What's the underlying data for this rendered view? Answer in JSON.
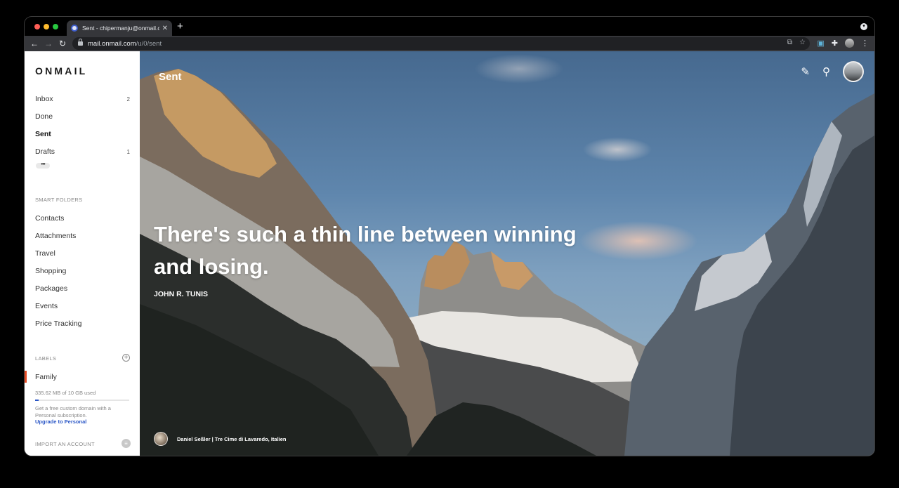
{
  "browser": {
    "tab_title": "Sent - chipermanju@onmail.com",
    "new_tab": "+",
    "url_host": "mail.onmail.com",
    "url_path": "/u/0/sent"
  },
  "sidebar": {
    "logo": "ONMAIL",
    "nav": [
      {
        "label": "Inbox",
        "count": "2"
      },
      {
        "label": "Done",
        "count": ""
      },
      {
        "label": "Sent",
        "count": ""
      },
      {
        "label": "Drafts",
        "count": "1"
      }
    ],
    "more": "•••",
    "smart_folders_heading": "SMART FOLDERS",
    "smart_folders": [
      "Contacts",
      "Attachments",
      "Travel",
      "Shopping",
      "Packages",
      "Events",
      "Price Tracking"
    ],
    "labels_heading": "LABELS",
    "labels": [
      "Family"
    ],
    "storage_text": "335.62 MB of 10 GB used",
    "storage_fraction": 0.034,
    "promo_text": "Get a free custom domain with a Personal subscription.",
    "upgrade_link": "Upgrade to Personal",
    "import_heading": "IMPORT AN ACCOUNT"
  },
  "main": {
    "title": "Sent",
    "quote": "There's such a thin line between winning and losing.",
    "author": "JOHN R. TUNIS",
    "photo_credit": "Daniel Seßler | Tre Cime di Lavaredo, Italien"
  },
  "colors": {
    "accent": "#2a56c6",
    "label_family": "#e54b24"
  }
}
